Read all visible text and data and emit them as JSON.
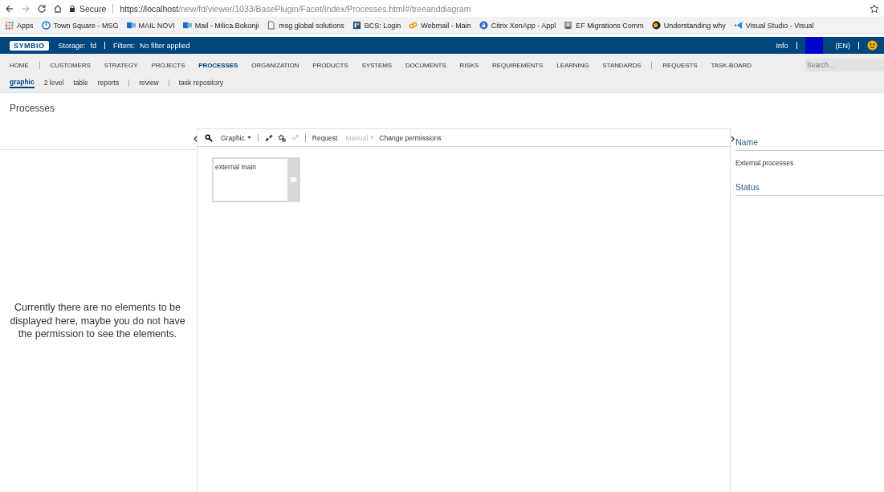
{
  "browser": {
    "secure_label": "Secure",
    "url_host": "https://localhost",
    "url_path": "/new/fd/viewer/1033/BasePlugin/Facet/Index/Processes.html#/treeanddiagram",
    "bookmarks": [
      {
        "label": "Apps",
        "kind": "apps"
      },
      {
        "label": "Town Square - MSG",
        "kind": "clock"
      },
      {
        "label": "MAIL NOVI",
        "kind": "mail"
      },
      {
        "label": "Mail - Milica.Bokonji",
        "kind": "mail"
      },
      {
        "label": "msg global solutions",
        "kind": "page"
      },
      {
        "label": "BCS: Login",
        "kind": "board"
      },
      {
        "label": "Webmail - Main",
        "kind": "chain"
      },
      {
        "label": "Citrix XenApp - Appl",
        "kind": "lock"
      },
      {
        "label": "EF Migrations Comm",
        "kind": "photo"
      },
      {
        "label": "Understanding why",
        "kind": "ninja"
      },
      {
        "label": "Visual Studio - Visual",
        "kind": "vs"
      }
    ]
  },
  "header": {
    "logo": "SYMBIO",
    "storage_label": "Storage:",
    "storage": "fd",
    "filters_label": "Filters:",
    "filters": "No filter applied",
    "info": "Info",
    "language": "(EN)"
  },
  "nav_groups": [
    [
      {
        "label": "HOME",
        "selected": false
      }
    ],
    [
      {
        "label": "CUSTOMERS",
        "selected": false
      },
      {
        "label": "STRATEGY",
        "selected": false
      },
      {
        "label": "PROJECTS",
        "selected": false
      },
      {
        "label": "PROCESSES",
        "selected": true
      },
      {
        "label": "ORGANIZATION",
        "selected": false
      },
      {
        "label": "PRODUCTS",
        "selected": false
      },
      {
        "label": "SYSTEMS",
        "selected": false
      },
      {
        "label": "DOCUMENTS",
        "selected": false
      },
      {
        "label": "RISKS",
        "selected": false
      },
      {
        "label": "REQUIREMENTS",
        "selected": false
      },
      {
        "label": "LEARNING",
        "selected": false
      },
      {
        "label": "STANDARDS",
        "selected": false
      }
    ],
    [
      {
        "label": "REQUESTS",
        "selected": false
      },
      {
        "label": "TASK-BOARD",
        "selected": false
      }
    ]
  ],
  "search": {
    "placeholder": "Search..."
  },
  "subnav_groups": [
    [
      {
        "label": "graphic",
        "selected": true
      },
      {
        "label": "2 level",
        "selected": false
      },
      {
        "label": "table",
        "selected": false
      },
      {
        "label": "reports",
        "selected": false
      }
    ],
    [
      {
        "label": "review",
        "selected": false
      }
    ],
    [
      {
        "label": "task repository",
        "selected": false
      }
    ]
  ],
  "page_title": "Processes",
  "left_panel": {
    "message": "Currently there are no elements to be displayed here, maybe you do not have the permission to see the elements."
  },
  "toolbar": {
    "view_dropdown": {
      "label": "Graphic",
      "disabled": false
    },
    "request": "Request",
    "manual_dropdown": {
      "label": "Manual",
      "disabled": true
    },
    "change_permissions": "Change permissions"
  },
  "diagram": {
    "nodes": [
      {
        "label": "external main"
      }
    ]
  },
  "details": {
    "name_heading": "Name",
    "name_value": "External processes",
    "status_heading": "Status"
  }
}
